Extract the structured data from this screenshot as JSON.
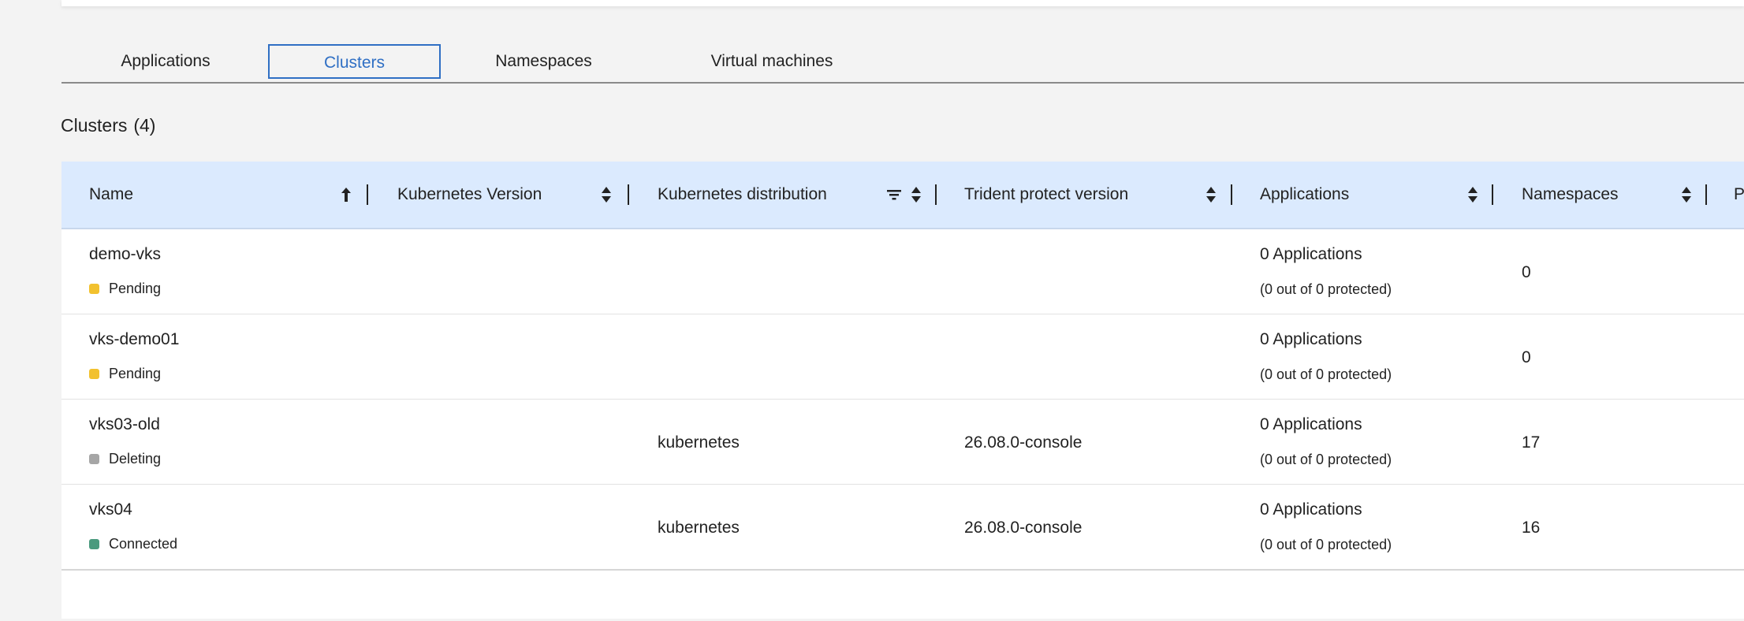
{
  "tabs": [
    {
      "label": "Applications"
    },
    {
      "label": "Clusters"
    },
    {
      "label": "Namespaces"
    },
    {
      "label": "Virtual machines"
    }
  ],
  "section": {
    "title": "Clusters",
    "count": "(4)"
  },
  "columns": {
    "name": "Name",
    "k8s_version": "Kubernetes Version",
    "k8s_distribution": "Kubernetes distribution",
    "trident_version": "Trident protect version",
    "applications": "Applications",
    "namespaces": "Namespaces",
    "partial": "P"
  },
  "rows": [
    {
      "name": "demo-vks",
      "status": "Pending",
      "status_color": "#f2c12e",
      "k8s_version": "",
      "distribution": "",
      "trident": "",
      "apps": "0 Applications",
      "apps_sub": "(0 out of 0 protected)",
      "namespaces": "0"
    },
    {
      "name": "vks-demo01",
      "status": "Pending",
      "status_color": "#f2c12e",
      "k8s_version": "",
      "distribution": "",
      "trident": "",
      "apps": "0 Applications",
      "apps_sub": "(0 out of 0 protected)",
      "namespaces": "0"
    },
    {
      "name": "vks03-old",
      "status": "Deleting",
      "status_color": "#a6a6a6",
      "k8s_version": "",
      "distribution": "kubernetes",
      "trident": "26.08.0-console",
      "apps": "0 Applications",
      "apps_sub": "(0 out of 0 protected)",
      "namespaces": "17"
    },
    {
      "name": "vks04",
      "status": "Connected",
      "status_color": "#4a9a7e",
      "k8s_version": "",
      "distribution": "kubernetes",
      "trident": "26.08.0-console",
      "apps": "0 Applications",
      "apps_sub": "(0 out of 0 protected)",
      "namespaces": "16"
    }
  ]
}
